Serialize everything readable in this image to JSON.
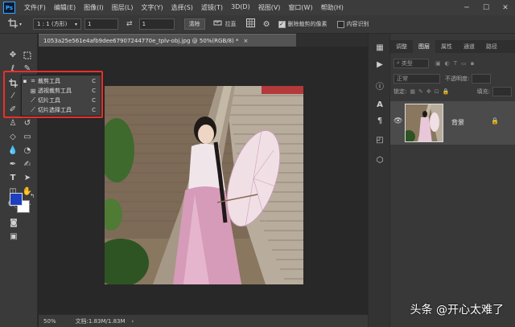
{
  "app": {
    "logo": "Ps"
  },
  "menubar": {
    "items": [
      "文件(F)",
      "编辑(E)",
      "图像(I)",
      "图层(L)",
      "文字(Y)",
      "选择(S)",
      "滤镜(T)",
      "3D(D)",
      "视图(V)",
      "窗口(W)",
      "帮助(H)"
    ],
    "window_controls": {
      "minimize": "─",
      "maximize": "☐",
      "close": "✕"
    }
  },
  "options_bar": {
    "ratio_preset": "1 : 1 (方形)",
    "width_value": "1",
    "height_value": "1",
    "clear_label": "清除",
    "straighten_label": "拉直",
    "delete_cropped_label": "删除裁剪的像素",
    "delete_cropped_checked": true,
    "content_aware_label": "内容识别",
    "content_aware_checked": false
  },
  "document": {
    "tab_title": "1053a25e561e4afb9dee67907244770e_tplv-obj.jpg @ 50%(RGB/8) *",
    "close_glyph": "×",
    "zoom": "50%",
    "doc_size": "文档:1.83M/1.83M"
  },
  "crop_flyout": {
    "items": [
      {
        "label": "裁剪工具",
        "shortcut": "C",
        "selected": true,
        "icon": "crop-icon"
      },
      {
        "label": "透视裁剪工具",
        "shortcut": "C",
        "selected": false,
        "icon": "perspective-crop-icon"
      },
      {
        "label": "切片工具",
        "shortcut": "C",
        "selected": false,
        "icon": "slice-icon"
      },
      {
        "label": "切片选择工具",
        "shortcut": "C",
        "selected": false,
        "icon": "slice-select-icon"
      }
    ]
  },
  "layers_panel": {
    "tabs": [
      "调整",
      "图层",
      "属性",
      "通道",
      "路径"
    ],
    "active_tab": "图层",
    "kind_filter": "类型",
    "blend_mode": "正常",
    "opacity_label": "不透明度:",
    "lock_label": "锁定:",
    "fill_label": "填充:",
    "layer_name": "背景"
  },
  "colors": {
    "accent": "#31a8ff",
    "highlight_box": "#e8302a",
    "foreground": "#1e3fbf",
    "background": "#ffffff"
  },
  "watermark": "头条 @开心太难了"
}
